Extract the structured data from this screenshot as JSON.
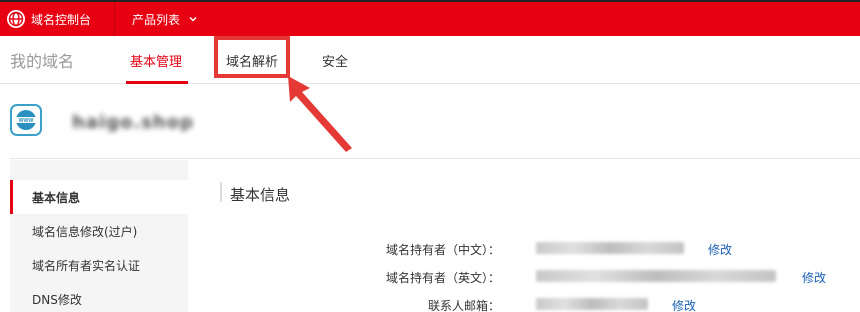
{
  "topbar": {
    "brand_label": "域名控制台",
    "product_menu_label": "产品列表"
  },
  "subnav": {
    "section_title": "我的域名",
    "tabs": [
      {
        "label": "基本管理",
        "active": true
      },
      {
        "label": "域名解析",
        "active": false
      },
      {
        "label": "安全",
        "active": false
      }
    ]
  },
  "domain": {
    "name": "haigo.shop"
  },
  "sidebar": {
    "items": [
      {
        "label": "基本信息",
        "active": true
      },
      {
        "label": "域名信息修改(过户)",
        "active": false
      },
      {
        "label": "域名所有者实名认证",
        "active": false
      },
      {
        "label": "DNS修改",
        "active": false
      }
    ]
  },
  "content": {
    "title": "基本信息",
    "rows": [
      {
        "label": "域名持有者（中文）：",
        "edit_label": "修改"
      },
      {
        "label": "域名持有者（英文）：",
        "edit_label": "修改"
      },
      {
        "label": "联系人邮箱：",
        "edit_label": "修改"
      }
    ]
  },
  "colors": {
    "brand_red": "#e60012",
    "annotation_red": "#e53935",
    "link_blue": "#1a5fb4"
  }
}
